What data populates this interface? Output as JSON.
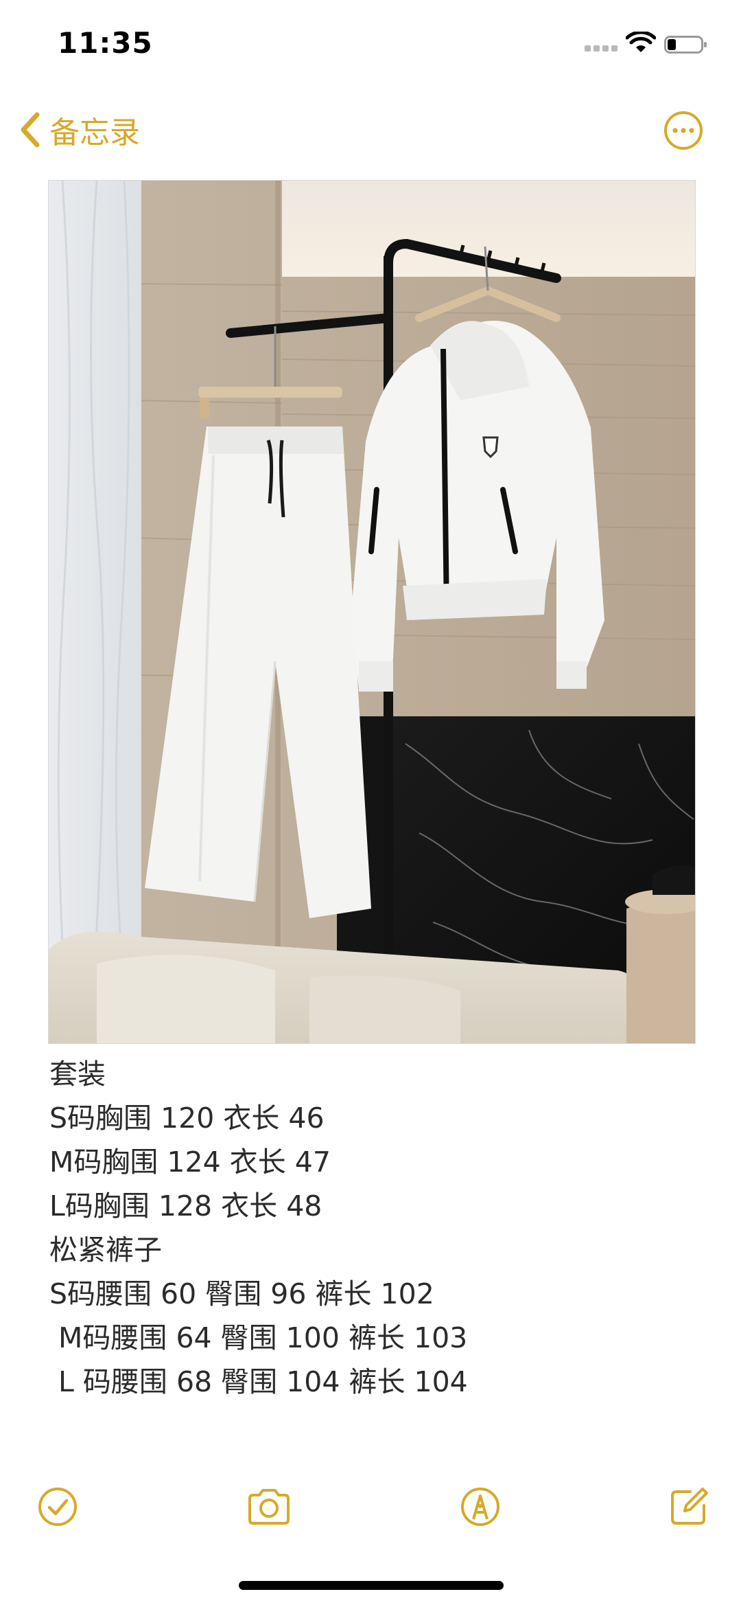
{
  "status_bar": {
    "time": "11:35"
  },
  "nav": {
    "back_label": "备忘录"
  },
  "icons": {
    "back": "chevron-left-icon",
    "more": "ellipsis-circle-icon",
    "checklist": "checkmark-circle-icon",
    "camera": "camera-icon",
    "markup": "pen-tip-circle-icon",
    "compose": "compose-icon"
  },
  "colors": {
    "accent": "#d6a92a",
    "text": "#2b2b2d"
  },
  "note": {
    "lines": [
      "套装",
      "S码胸围 120 衣长 46",
      "M码胸围 124 衣长 47",
      "L码胸围 128 衣长 48",
      "松紧裤子",
      "S码腰围 60 臀围 96 裤长 102",
      " M码腰围 64 臀围 100 裤长 103",
      " L 码腰围 68 臀围 104 裤长 104"
    ]
  }
}
